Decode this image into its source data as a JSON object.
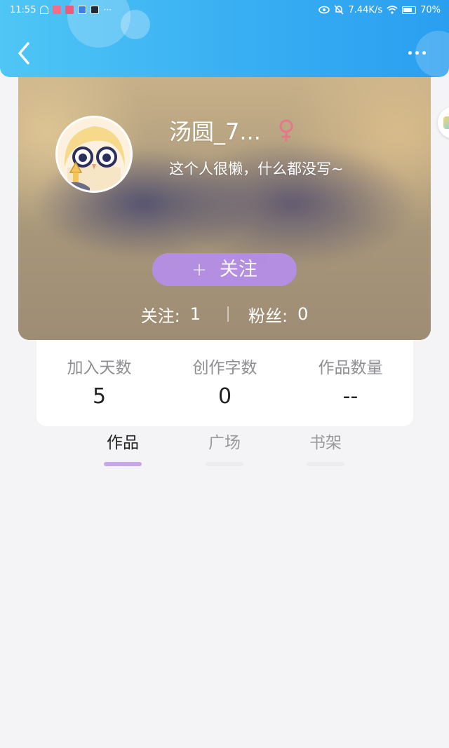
{
  "status_bar": {
    "time": "11:55",
    "network_speed": "7.44K/s",
    "battery": "70%"
  },
  "header": {
    "back_icon": "chevron-left-icon",
    "more_icon": "more-dots-icon",
    "gradient_colors": [
      "#4fc6f5",
      "#2a9ff0"
    ]
  },
  "profile": {
    "username": "汤圆_7...",
    "gender_icon": "female-icon",
    "gender_color": "#e3788a",
    "bio": "这个人很懒，什么都没写~",
    "follow_button": {
      "plus": "+",
      "label": "关注",
      "color": "#b58ee6"
    },
    "following_label": "关注:",
    "following_count": "1",
    "followers_label": "粉丝:",
    "followers_count": "0"
  },
  "stats": [
    {
      "label": "加入天数",
      "value": "5"
    },
    {
      "label": "创作字数",
      "value": "0"
    },
    {
      "label": "作品数量",
      "value": "--"
    }
  ],
  "tabs": [
    {
      "label": "作品",
      "active": true
    },
    {
      "label": "广场",
      "active": false
    },
    {
      "label": "书架",
      "active": false
    }
  ],
  "accent_color": "#c7a6e8"
}
